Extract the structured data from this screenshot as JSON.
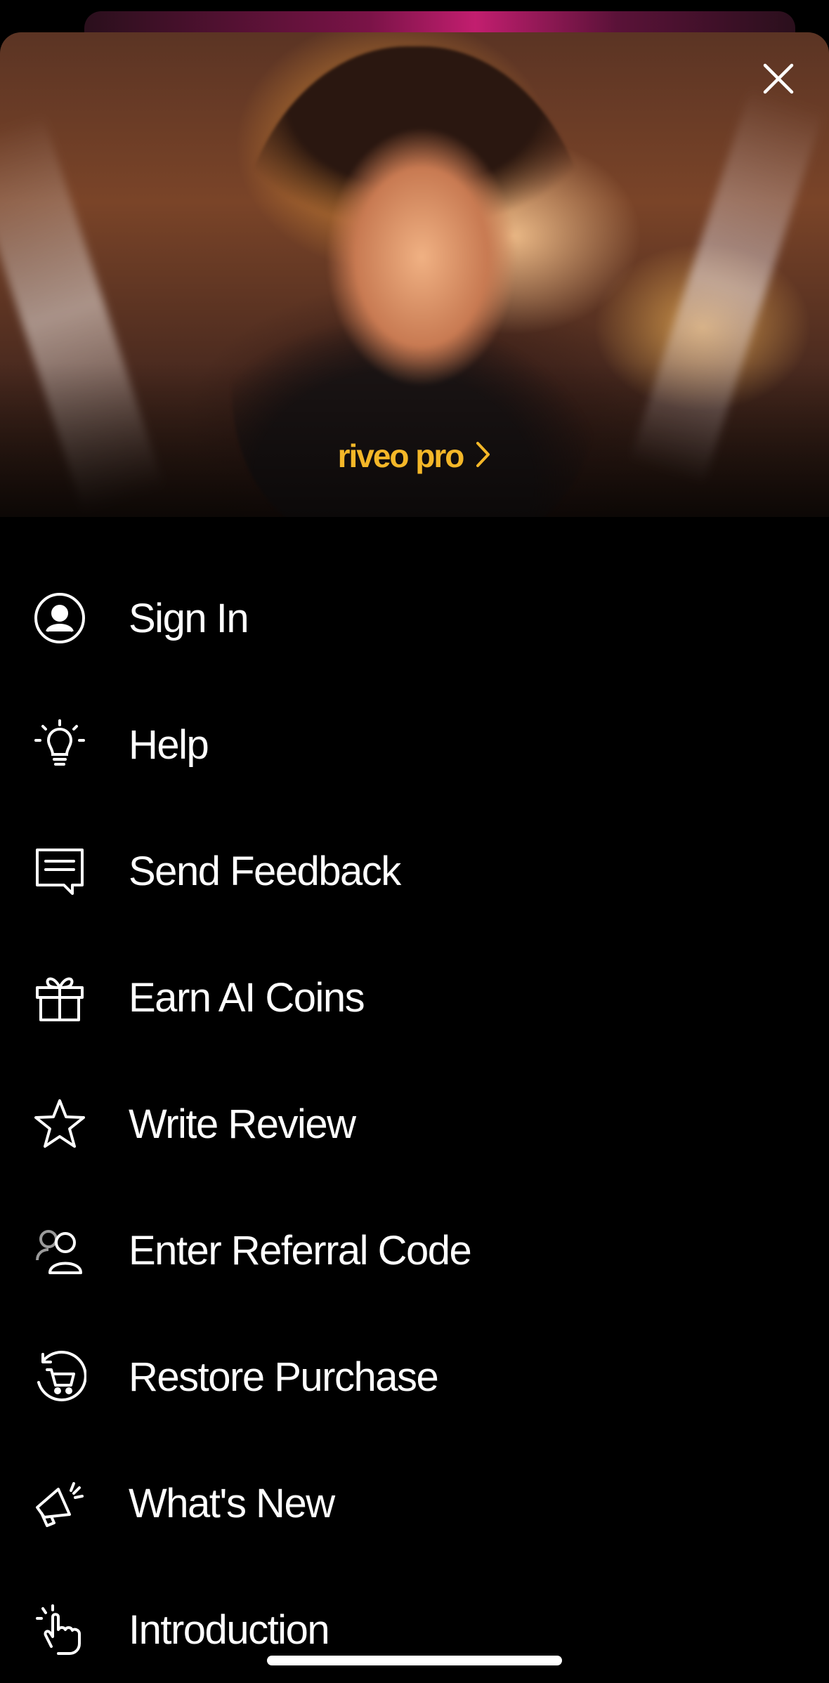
{
  "promo": {
    "label": "riveo pro",
    "accent_color": "#f4b728"
  },
  "close": {
    "icon": "close-icon"
  },
  "menu": [
    {
      "label": "Sign In",
      "icon": "user-circle-icon"
    },
    {
      "label": "Help",
      "icon": "lightbulb-icon"
    },
    {
      "label": "Send Feedback",
      "icon": "message-icon"
    },
    {
      "label": "Earn AI Coins",
      "icon": "gift-icon"
    },
    {
      "label": "Write Review",
      "icon": "star-icon"
    },
    {
      "label": "Enter Referral Code",
      "icon": "users-icon"
    },
    {
      "label": "Restore Purchase",
      "icon": "cart-refresh-icon"
    },
    {
      "label": "What's New",
      "icon": "megaphone-icon"
    },
    {
      "label": "Introduction",
      "icon": "pointer-hand-icon"
    }
  ]
}
